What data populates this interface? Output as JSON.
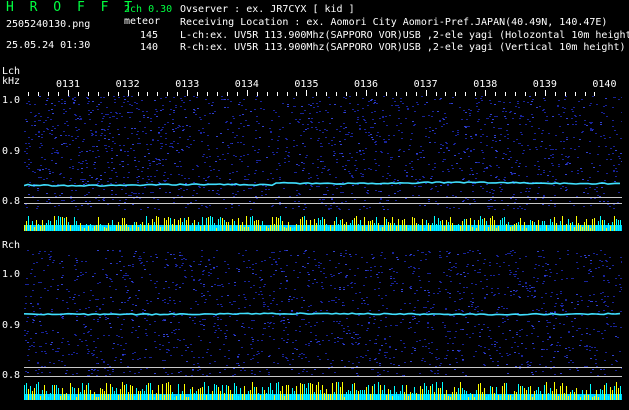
{
  "header": {
    "title": "H R O F F T",
    "mode": "2ch 0.30",
    "filename": "2505240130.png",
    "category": "meteor",
    "datetime": "25.05.24 01:30",
    "count_l": "145",
    "count_r": "140",
    "observer": "Ovserver                : ex. JR7CYX [ kid ]",
    "location": "Receiving Location : ex. Aomori City Aomori-Pref.JAPAN(40.49N, 140.47E)",
    "lch_info": "L-ch:ex. UV5R 113.900Mhz(SAPPORO VOR)USB ,2-ele yagi (Holozontal 10m height)",
    "rch_info": "R-ch:ex. UV5R 113.900Mhz(SAPPORO VOR)USB ,2-ele yagi (Vertical 10m height)"
  },
  "time_axis": [
    "0131",
    "0132",
    "0133",
    "0134",
    "0135",
    "0136",
    "0137",
    "0138",
    "0139",
    "0140"
  ],
  "lch": {
    "label": "Lch",
    "unit": "kHz",
    "yticks": [
      "1.0",
      "0.9",
      "0.8"
    ]
  },
  "rch": {
    "label": "Rch",
    "yticks": [
      "1.0",
      "0.9",
      "0.8"
    ]
  },
  "colors": {
    "trace": "#40ffff",
    "noise": "#1a2aa0",
    "bars_yellow": "#ffff00",
    "bars_cyan": "#00ffff",
    "label_green": "#00ff40"
  }
}
